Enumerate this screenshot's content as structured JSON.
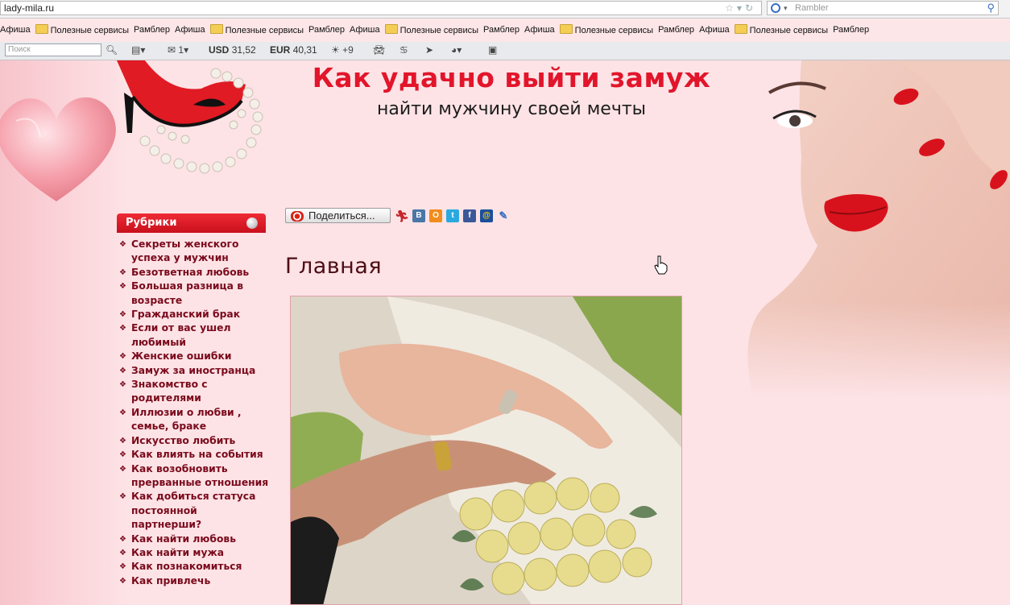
{
  "browser": {
    "url": "lady-mila.ru",
    "search_placeholder": "Rambler",
    "bookmarks": [
      {
        "label": "Афиша",
        "type": "page-plain"
      },
      {
        "label": "Полезные сервисы",
        "type": "folder"
      },
      {
        "label": "Рамблер",
        "type": "page"
      },
      {
        "label": "Афиша",
        "type": "page"
      },
      {
        "label": "Полезные сервисы",
        "type": "folder"
      },
      {
        "label": "Рамблер",
        "type": "page"
      },
      {
        "label": "Афиша",
        "type": "page"
      },
      {
        "label": "Полезные сервисы",
        "type": "folder"
      },
      {
        "label": "Рамблер",
        "type": "page"
      },
      {
        "label": "Афиша",
        "type": "page"
      },
      {
        "label": "Полезные сервисы",
        "type": "folder"
      },
      {
        "label": "Рамблер",
        "type": "page"
      },
      {
        "label": "Афиша",
        "type": "page"
      },
      {
        "label": "Полезные сервисы",
        "type": "folder"
      },
      {
        "label": "Рамблер",
        "type": "page"
      }
    ],
    "toolbar": {
      "search_placeholder": "Поиск",
      "mail_count": "1",
      "usd_label": "USD",
      "usd_value": "31,52",
      "eur_label": "EUR",
      "eur_value": "40,31",
      "weather": "+9"
    }
  },
  "site": {
    "title": "Как удачно выйти замуж",
    "subtitle": "найти мужчину своей мечты",
    "categories_header": "Рубрики",
    "categories": [
      "Секреты женского успеха у мужчин",
      "Безответная любовь",
      "Большая разница в возрасте",
      "Гражданский брак",
      "Если от вас ушел любимый",
      "Женские ошибки",
      "Замуж за иностранца",
      "Знакомство с родителями",
      "Иллюзии о любви , семье, браке",
      "Искусство любить",
      "Как влиять на события",
      "Как возобновить прерванные отношения",
      "Как добиться статуса постоянной партнерши?",
      "Как найти любовь",
      "Как найти мужа",
      "Как познакомиться",
      "Как привлечь"
    ],
    "share_label": "Поделиться...",
    "main_heading": "Главная",
    "colors": {
      "title_red": "#e2152b",
      "category_text": "#7a0a1c",
      "page_background": "#fde3e6"
    }
  }
}
